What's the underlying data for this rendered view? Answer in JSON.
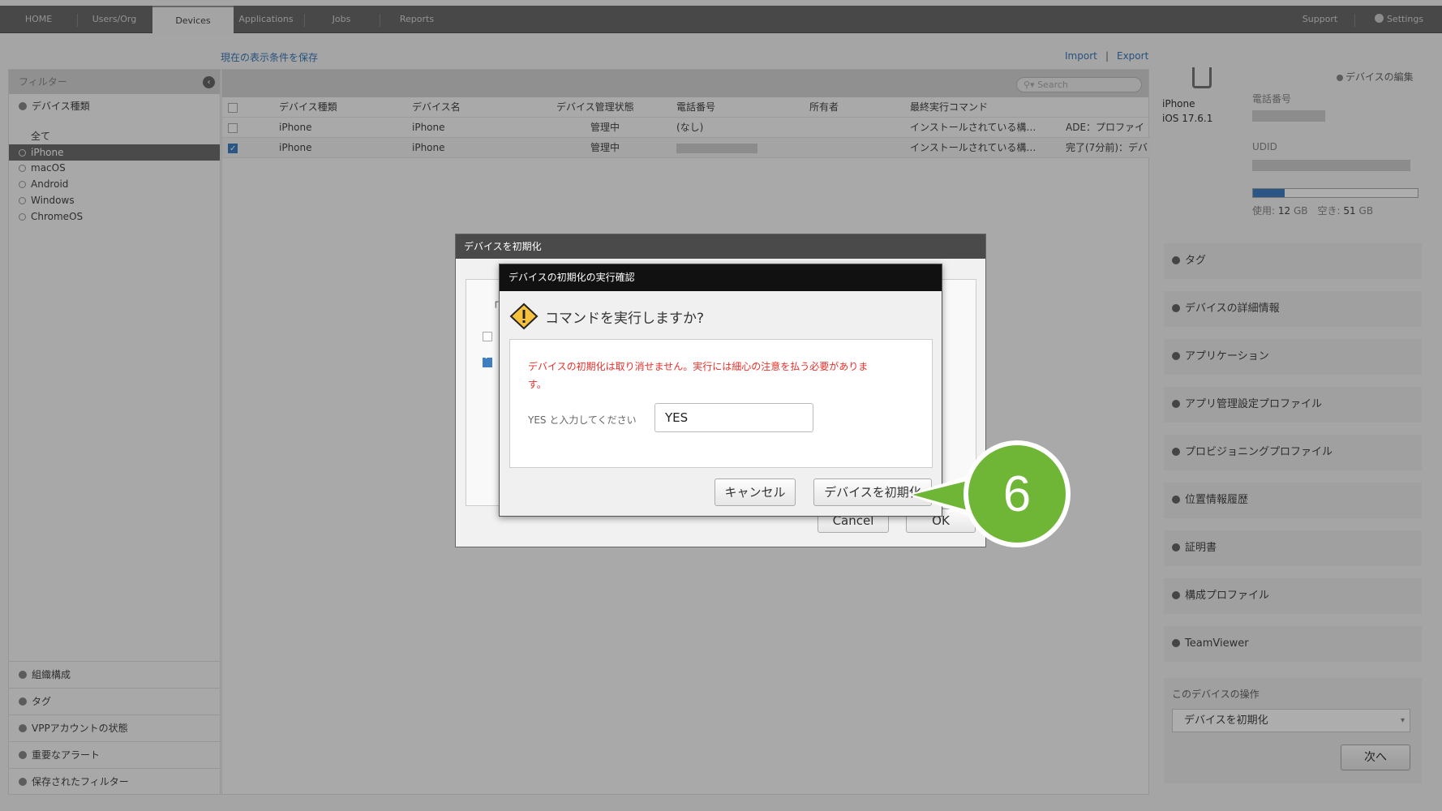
{
  "nav": {
    "tabs": [
      "HOME",
      "Users/Org",
      "Devices",
      "Applications",
      "Jobs",
      "Reports"
    ],
    "support": "Support",
    "settings": "Settings"
  },
  "links": {
    "save_view": "現在の表示条件を保存",
    "import": "Import",
    "separator": "|",
    "export": "Export"
  },
  "filter": {
    "title": "フィルター",
    "section": "デバイス種類",
    "items": [
      "全て",
      "iPhone",
      "macOS",
      "Android",
      "Windows",
      "ChromeOS"
    ],
    "bottom": [
      "組織構成",
      "タグ",
      "VPPアカウントの状態",
      "重要なアラート",
      "保存されたフィルター"
    ]
  },
  "table": {
    "search_placeholder": "Search",
    "headers": [
      "デバイス種類",
      "デバイス名",
      "デバイス管理状態",
      "電話番号",
      "所有者",
      "最終実行コマンド"
    ],
    "rows": [
      {
        "type": "iPhone",
        "name": "iPhone",
        "state": "管理中",
        "phone": "(なし)",
        "cmd": "インストールされている構…",
        "result": "ADE：プロファイ"
      },
      {
        "type": "iPhone",
        "name": "iPhone",
        "state": "管理中",
        "phone": "",
        "cmd": "インストールされている構…",
        "result": "完了(7分前)：デバ"
      }
    ]
  },
  "right": {
    "edit": "デバイスの編集",
    "device_name": "iPhone",
    "os": "iOS 17.6.1",
    "phone_label": "電話番号",
    "udid_label": "UDID",
    "storage": {
      "used_label": "使用:",
      "used": "12",
      "unit": "GB",
      "free_label": "空き:",
      "free": "51",
      "used_fraction": 0.19
    },
    "sections": [
      "タグ",
      "デバイスの詳細情報",
      "アプリケーション",
      "アプリ管理設定プロファイル",
      "プロビジョニングプロファイル",
      "位置情報履歴",
      "証明書",
      "構成プロファイル",
      "TeamViewer"
    ],
    "ops_title": "このデバイスの操作",
    "ops_select": "デバイスを初期化",
    "next": "次へ"
  },
  "dialog_back": {
    "title": "デバイスを初期化",
    "peek": "「デ",
    "cancel": "Cancel",
    "ok": "OK"
  },
  "dialog_front": {
    "title": "デバイスの初期化の実行確認",
    "question": "コマンドを実行しますか?",
    "warning_line1": "デバイスの初期化は取り消せません。実行には細心の注意を払う必要がありま",
    "warning_line2": "す。",
    "input_label": "YES と入力してください",
    "input_value": "YES",
    "cancel": "キャンセル",
    "confirm": "デバイスを初期化"
  },
  "callout": {
    "number": "6",
    "color": "#6fb536"
  }
}
